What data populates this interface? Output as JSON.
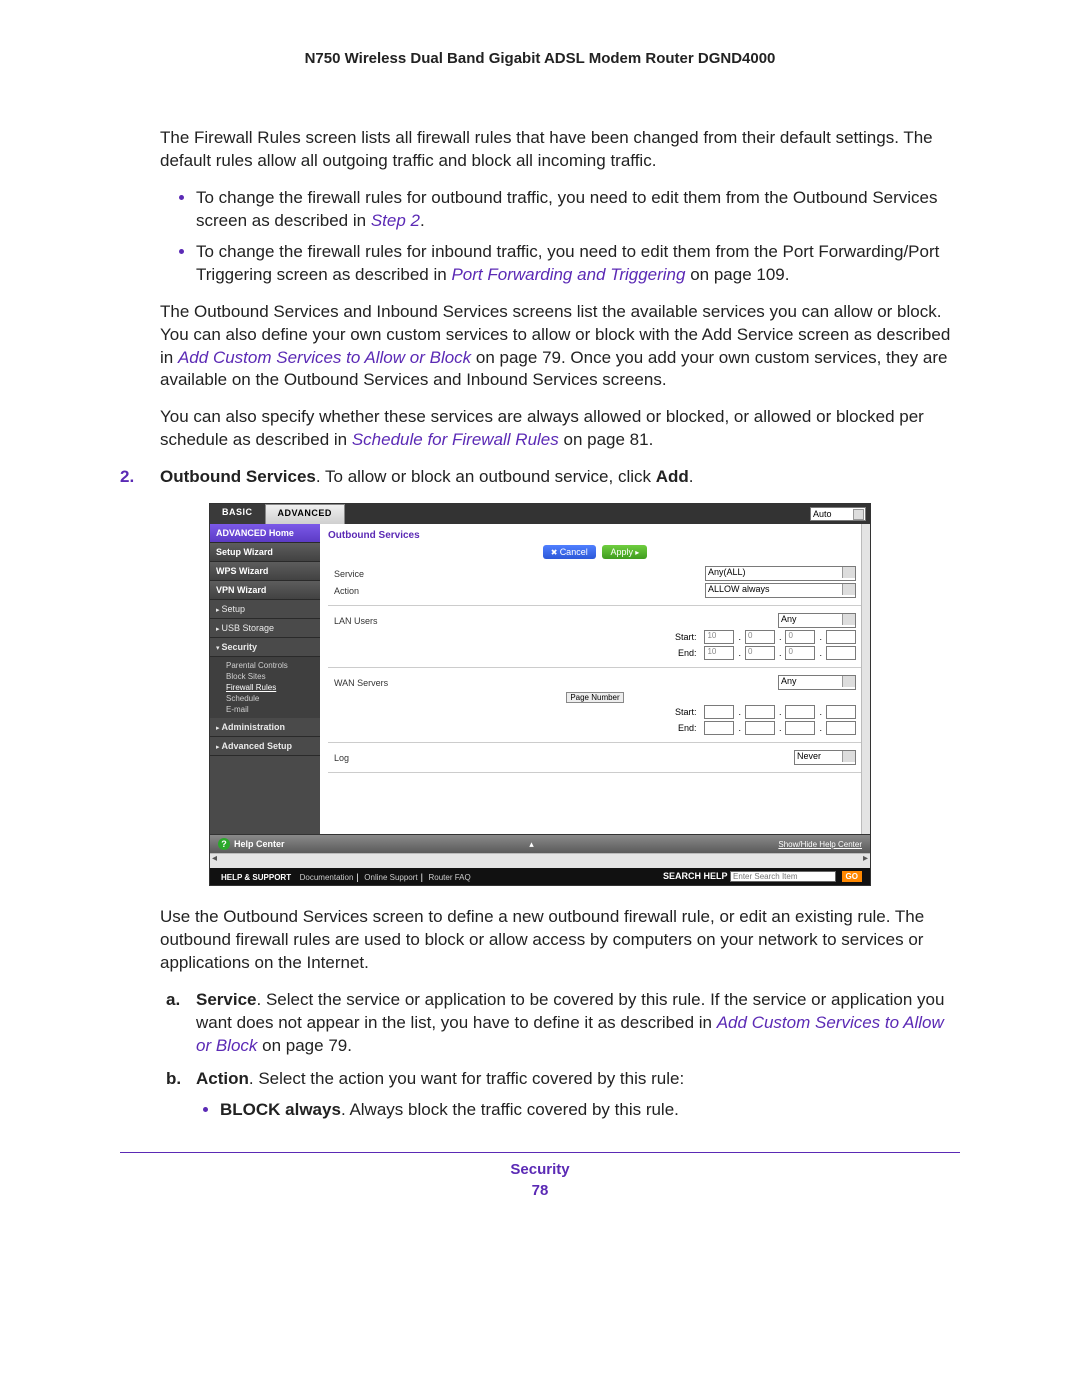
{
  "header": {
    "title": "N750 Wireless Dual Band Gigabit ADSL Modem Router DGND4000"
  },
  "body": {
    "p1": "The Firewall Rules screen lists all firewall rules that have been changed from their default settings. The default rules allow all outgoing traffic and block all incoming traffic.",
    "b1a": "To change the firewall rules for outbound traffic, you need to edit them from the Outbound Services screen as described in ",
    "b1link": "Step 2",
    "b1b": ".",
    "b2a": "To change the firewall rules for inbound traffic, you need to edit them from the Port Forwarding/Port Triggering screen as described in ",
    "b2link": "Port Forwarding and Triggering",
    "b2b": " on page 109.",
    "p2a": "The Outbound Services and Inbound Services screens list the available services you can allow or block. You can also define your own custom services to allow or block with the Add Service screen as described in ",
    "p2link": "Add Custom Services to Allow or Block",
    "p2b": " on page 79. Once you add your own custom services, they are available on the Outbound Services and Inbound Services screens.",
    "p3a": "You can also specify whether these services are always allowed or blocked, or allowed or blocked per schedule as described in ",
    "p3link": "Schedule for Firewall Rules",
    "p3b": " on page 81.",
    "num2_label": "2.",
    "num2_bold": "Outbound Services",
    "num2_text": ". To allow or block an outbound service, click ",
    "num2_bold2": "Add",
    "num2_end": ".",
    "p_after": "Use the Outbound Services screen to define a new outbound firewall rule, or edit an existing rule. The outbound firewall rules are used to block or allow access by computers on your network to services or applications on the Internet.",
    "la_let": "a.",
    "la_bold": "Service",
    "la_text": ". Select the service or application to be covered by this rule. If the service or application you want does not appear in the list, you have to define it as described in ",
    "la_link": "Add Custom Services to Allow or Block",
    "la_text2": " on page 79.",
    "lb_let": "b.",
    "lb_bold": "Action",
    "lb_text": ". Select the action you want for traffic covered by this rule:",
    "lb_sub_bold": "BLOCK always",
    "lb_sub_text": ". Always block the traffic covered by this rule."
  },
  "ui": {
    "auto": "Auto",
    "tabs": {
      "basic": "BASIC",
      "advanced": "ADVANCED"
    },
    "sidebar": {
      "adv_home": "ADVANCED Home",
      "setup_wiz": "Setup Wizard",
      "wps_wiz": "WPS Wizard",
      "vpn_wiz": "VPN Wizard",
      "setup": "Setup",
      "usb": "USB Storage",
      "security": "Security",
      "sec_sub": {
        "parental": "Parental Controls",
        "block": "Block Sites",
        "fw": "Firewall Rules",
        "sched": "Schedule",
        "email": "E-mail"
      },
      "admin": "Administration",
      "advsetup": "Advanced Setup"
    },
    "panel": {
      "title": "Outbound Services",
      "cancel": "Cancel",
      "apply": "Apply",
      "service_lbl": "Service",
      "service_val": "Any(ALL)",
      "action_lbl": "Action",
      "action_val": "ALLOW always",
      "lan_lbl": "LAN Users",
      "any": "Any",
      "start": "Start:",
      "end": "End:",
      "ipseg0": "10",
      "ipseg1": "0",
      "wan_lbl": "WAN Servers",
      "page_number": "Page Number",
      "log_lbl": "Log",
      "log_val": "Never"
    },
    "helpbar": {
      "title": "Help Center",
      "link": "Show/Hide Help Center"
    },
    "support": {
      "label": "HELP & SUPPORT",
      "doc": "Documentation",
      "online": "Online Support",
      "faq": "Router FAQ",
      "search_label": "SEARCH HELP",
      "placeholder": "Enter Search Item",
      "go": "GO"
    }
  },
  "footer": {
    "section": "Security",
    "page": "78"
  }
}
